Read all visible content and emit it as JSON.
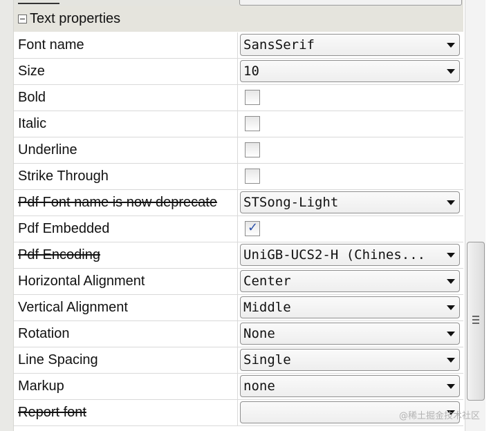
{
  "section": {
    "title": "Text properties"
  },
  "rows": [
    {
      "label": "Font name",
      "kind": "combo",
      "value": "SansSerif",
      "deprecated": false
    },
    {
      "label": "Size",
      "kind": "combo",
      "value": "10",
      "deprecated": false
    },
    {
      "label": "Bold",
      "kind": "checkbox",
      "checked": false,
      "deprecated": false
    },
    {
      "label": "Italic",
      "kind": "checkbox",
      "checked": false,
      "deprecated": false
    },
    {
      "label": "Underline",
      "kind": "checkbox",
      "checked": false,
      "deprecated": false
    },
    {
      "label": "Strike Through",
      "kind": "checkbox",
      "checked": false,
      "deprecated": false
    },
    {
      "label": "Pdf Font name is now deprecate",
      "kind": "combo",
      "value": "STSong-Light",
      "deprecated": true
    },
    {
      "label": "Pdf Embedded",
      "kind": "checkbox",
      "checked": true,
      "deprecated": false
    },
    {
      "label": "Pdf Encoding",
      "kind": "combo",
      "value": "UniGB-UCS2-H (Chines...",
      "deprecated": true
    },
    {
      "label": "Horizontal Alignment",
      "kind": "combo",
      "value": "Center",
      "deprecated": false
    },
    {
      "label": "Vertical Alignment",
      "kind": "combo",
      "value": "Middle",
      "deprecated": false
    },
    {
      "label": "Rotation",
      "kind": "combo",
      "value": "None",
      "deprecated": false
    },
    {
      "label": "Line Spacing",
      "kind": "combo",
      "value": "Single",
      "deprecated": false
    },
    {
      "label": "Markup",
      "kind": "combo",
      "value": "none",
      "deprecated": false
    },
    {
      "label": "Report font",
      "kind": "combo",
      "value": "",
      "deprecated": true
    }
  ],
  "watermark": "@稀土掘金技术社区",
  "colors": {
    "section_header_bg": "#e5e4dd",
    "checkbox_check": "#2a4fa8",
    "grid_line": "#d9d9d9"
  },
  "icons": {
    "collapse": "minus-square-icon",
    "dropdown": "chevron-down-icon",
    "check": "checkmark-icon",
    "scroll_grip": "grip-icon"
  }
}
